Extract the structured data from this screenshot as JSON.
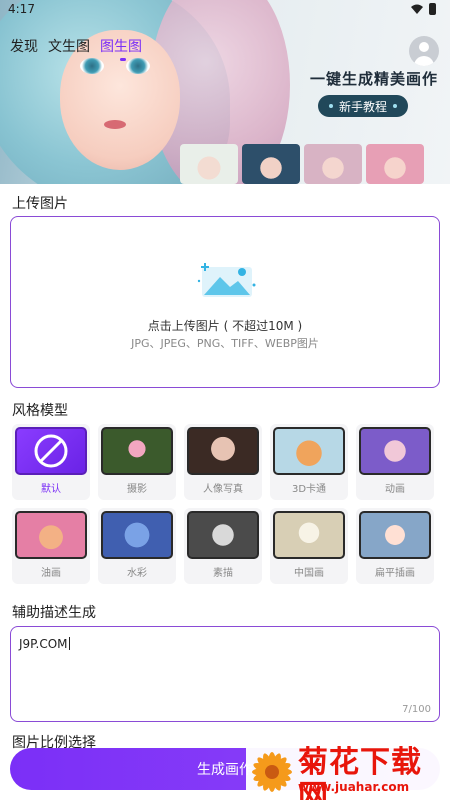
{
  "status_bar": {
    "time": "4:17"
  },
  "tabs": [
    {
      "label": "发现"
    },
    {
      "label": "文生图"
    },
    {
      "label": "图生图"
    }
  ],
  "banner": {
    "slogan": "一键生成精美画作",
    "tutorial_button": "新手教程"
  },
  "upload": {
    "section_title": "上传图片",
    "title": "点击上传图片 ( 不超过10M )",
    "formats": "JPG、JPEG、PNG、TIFF、WEBP图片"
  },
  "styles": {
    "section_title": "风格模型",
    "items": [
      {
        "label": "默认",
        "selected": true
      },
      {
        "label": "摄影"
      },
      {
        "label": "人像写真"
      },
      {
        "label": "3D卡通"
      },
      {
        "label": "动画"
      },
      {
        "label": "油画"
      },
      {
        "label": "水彩"
      },
      {
        "label": "素描"
      },
      {
        "label": "中国画"
      },
      {
        "label": "扁平插画"
      }
    ]
  },
  "prompt": {
    "section_title": "辅助描述生成",
    "value": "J9P.COM",
    "counter": "7/100"
  },
  "ratio": {
    "section_title": "图片比例选择"
  },
  "generate_button": "生成画作",
  "watermark": {
    "title": "菊花下载网",
    "url": "www.juahar.com"
  },
  "colors": {
    "accent": "#7b2ff7",
    "watermark": "#e8160b"
  }
}
